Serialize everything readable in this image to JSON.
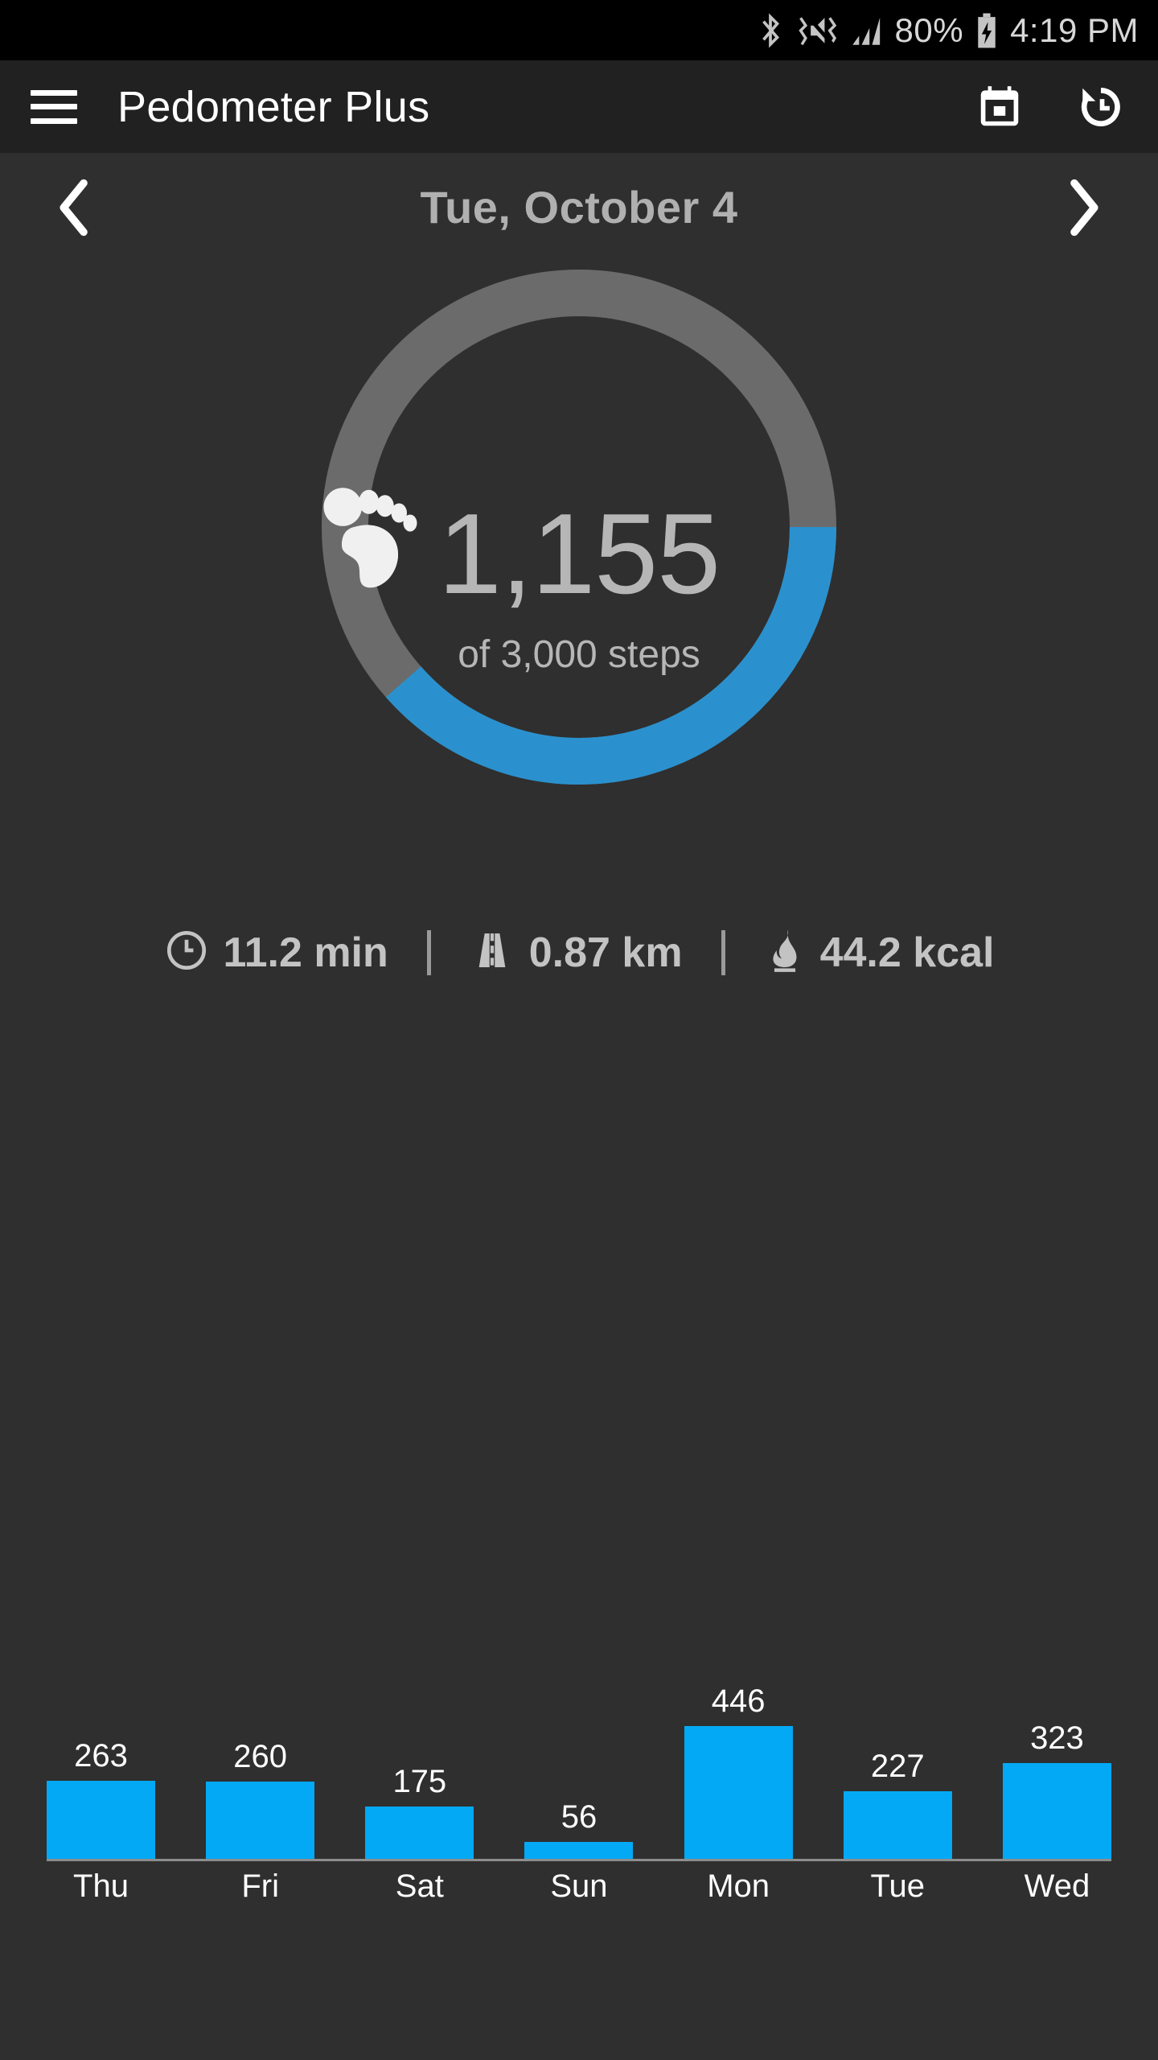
{
  "status_bar": {
    "battery_percent": "80%",
    "time": "4:19 PM",
    "icons": [
      "bluetooth-icon",
      "volume-mute-icon",
      "signal-bars-icon",
      "battery-charging-icon"
    ]
  },
  "app_bar": {
    "title": "Pedometer Plus",
    "menu_icon": "hamburger-menu-icon",
    "actions": [
      {
        "name": "calendar-icon",
        "label": "Calendar"
      },
      {
        "name": "history-icon",
        "label": "History"
      }
    ]
  },
  "date_nav": {
    "prev_label": "‹",
    "date": "Tue, October 4",
    "next_label": "›"
  },
  "progress_ring": {
    "icon": "footprint-icon",
    "steps": "1,155",
    "goal_text": "of 3,000 steps",
    "steps_value": 1155,
    "goal_value": 3000,
    "progress_fraction": 0.385,
    "track_color": "#6b6b6b",
    "progress_color": "#2a91ce"
  },
  "stats": [
    {
      "icon": "clock-icon",
      "value": "11.2 min"
    },
    {
      "icon": "road-icon",
      "value": "0.87 km"
    },
    {
      "icon": "flame-icon",
      "value": "44.2 kcal"
    }
  ],
  "chart_data": {
    "type": "bar",
    "title": "",
    "xlabel": "",
    "ylabel": "",
    "categories": [
      "Thu",
      "Fri",
      "Sat",
      "Sun",
      "Mon",
      "Tue",
      "Wed"
    ],
    "values": [
      263,
      260,
      175,
      56,
      446,
      227,
      323
    ],
    "ylim": [
      0,
      446
    ],
    "grid": false,
    "legend": false,
    "bar_color": "#03a9f4",
    "axis_color": "#8d8d8d",
    "label_color": "#ffffff"
  },
  "colors": {
    "page_background": "#2f2f2f",
    "appbar_background": "#212121",
    "statusbar_background": "#000000",
    "accent_blue": "#03a9f4",
    "ring_blue": "#2a91ce",
    "ring_gray": "#6b6b6b",
    "text_primary": "#ffffff",
    "text_secondary": "#b6b6b6"
  }
}
